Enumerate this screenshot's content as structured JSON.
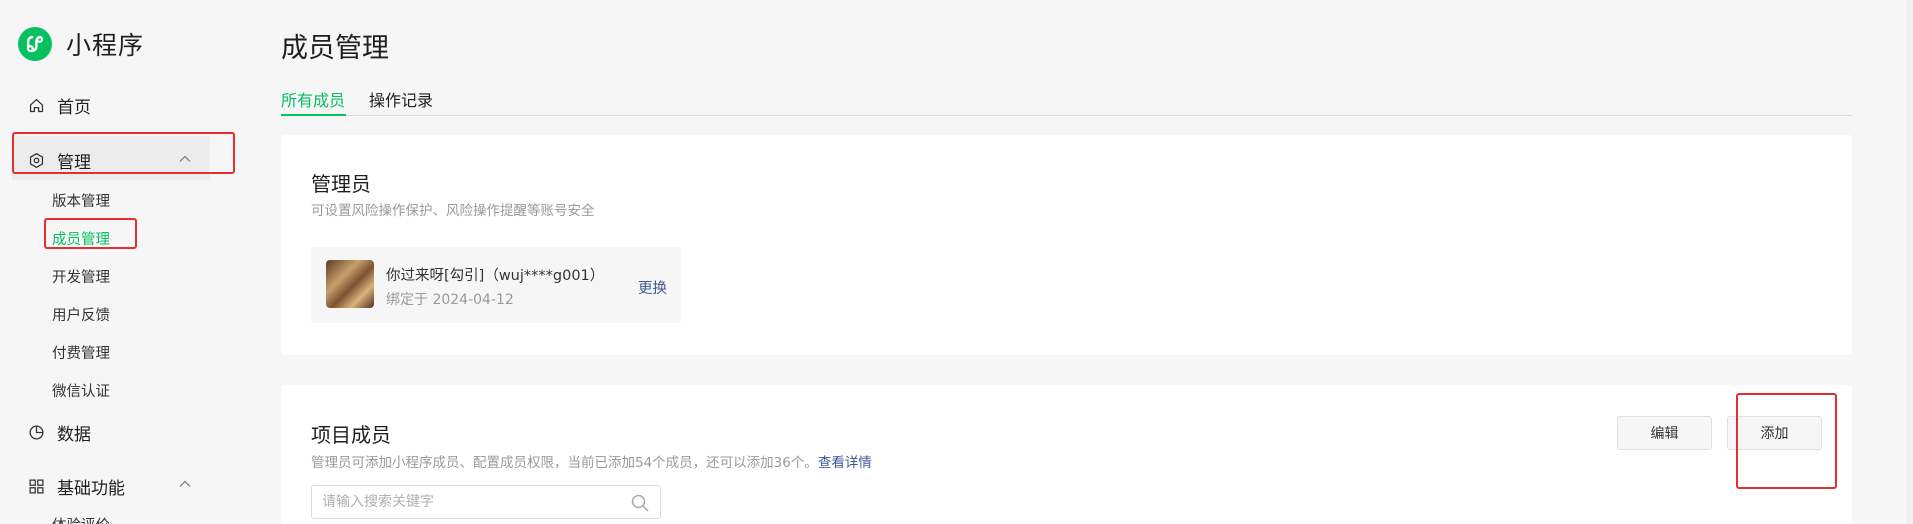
{
  "app": {
    "name": "小程序"
  },
  "sidebar": {
    "home": "首页",
    "manage": "管理",
    "manage_items": [
      "版本管理",
      "成员管理",
      "开发管理",
      "用户反馈",
      "付费管理",
      "微信认证"
    ],
    "data": "数据",
    "basic": "基础功能",
    "basic_items": [
      "体验评价"
    ]
  },
  "page": {
    "title": "成员管理",
    "tabs": [
      "所有成员",
      "操作记录"
    ]
  },
  "admin_card": {
    "title": "管理员",
    "desc": "可设置风险操作保护、风险操作提醒等账号安全",
    "name": "你过来呀[勾引]（wuj****g001）",
    "bound": "绑定于 2024-04-12",
    "change": "更换"
  },
  "members_card": {
    "title": "项目成员",
    "desc": "管理员可添加小程序成员、配置成员权限，当前已添加54个成员，还可以添加36个。",
    "detail_link": "查看详情",
    "edit_button": "编辑",
    "add_button": "添加",
    "search_placeholder": "请输入搜索关键字"
  },
  "colors": {
    "accent": "#07c160",
    "link": "#3d5a96",
    "highlight": "#e23030"
  }
}
